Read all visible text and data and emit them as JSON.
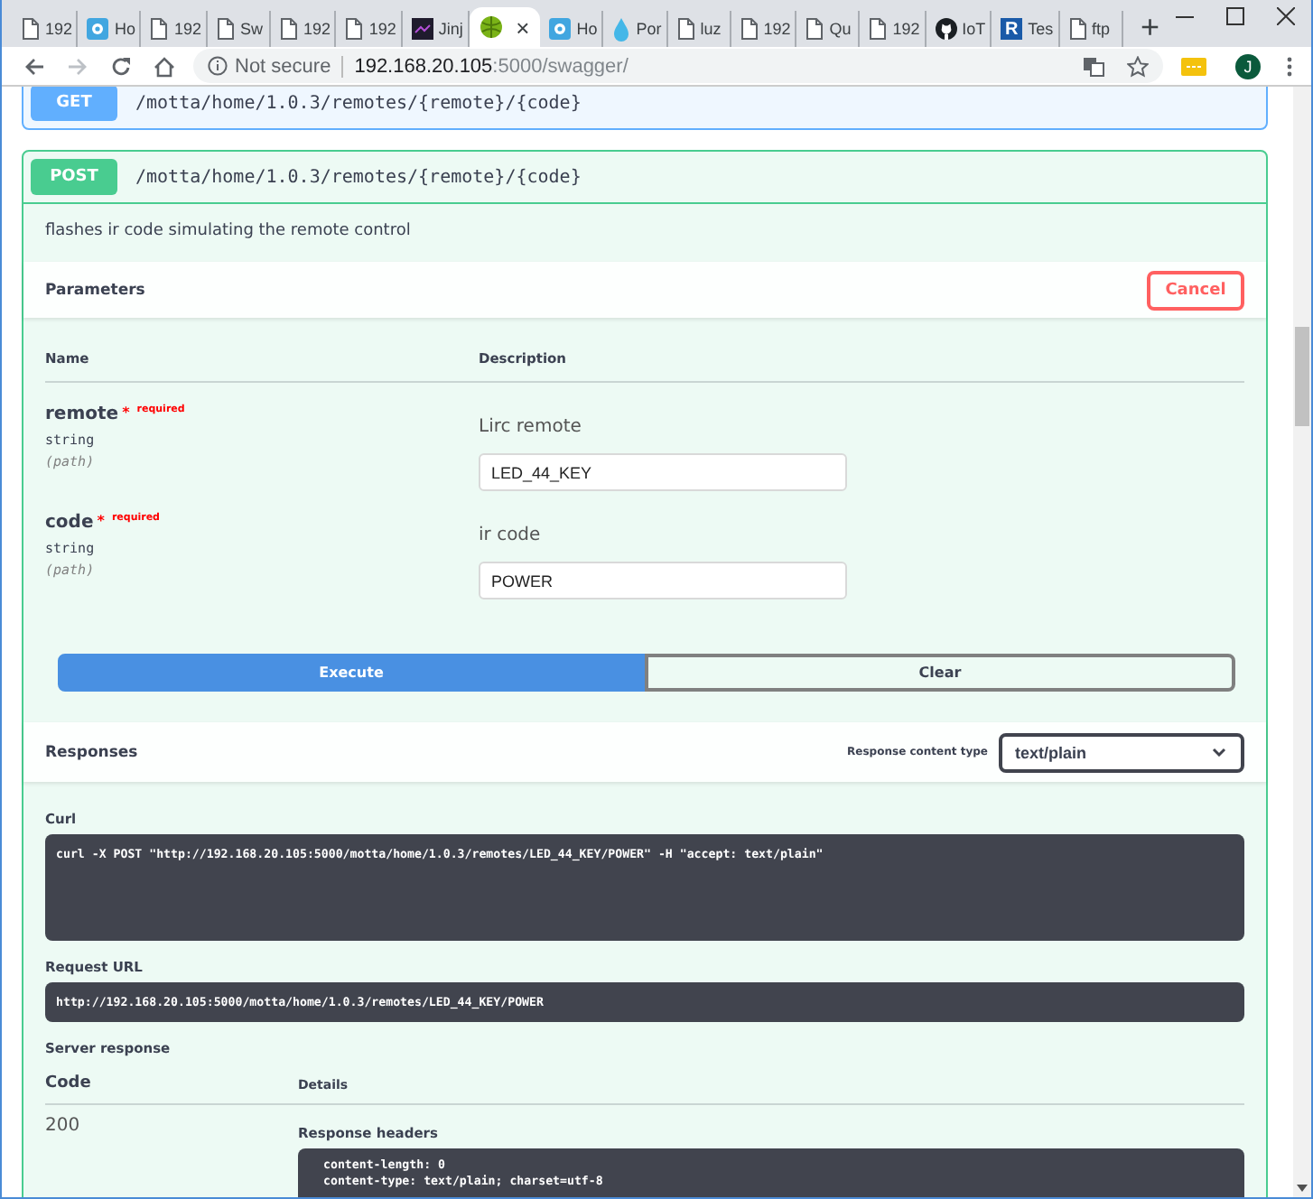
{
  "browser": {
    "tabs": [
      {
        "title": "192",
        "kind": "page",
        "selected": false
      },
      {
        "title": "Ho",
        "kind": "tile",
        "selected": false
      },
      {
        "title": "192",
        "kind": "page",
        "selected": false
      },
      {
        "title": "Sw",
        "kind": "page",
        "selected": false
      },
      {
        "title": "192",
        "kind": "page",
        "selected": false
      },
      {
        "title": "192",
        "kind": "page",
        "selected": false
      },
      {
        "title": "Jinj",
        "kind": "dark",
        "selected": false
      },
      {
        "kind": "ball",
        "selected": true,
        "close": "×"
      },
      {
        "title": "Ho",
        "kind": "tile",
        "selected": false
      },
      {
        "title": "Por",
        "kind": "drop",
        "selected": false
      },
      {
        "title": "luz",
        "kind": "page",
        "selected": false
      },
      {
        "title": "192",
        "kind": "page",
        "selected": false
      },
      {
        "title": "Qu",
        "kind": "page",
        "selected": false
      },
      {
        "title": "192",
        "kind": "page",
        "selected": false
      },
      {
        "title": "IoT",
        "kind": "cat",
        "selected": false
      },
      {
        "title": "Tes",
        "kind": "letter",
        "badge": "R",
        "selected": false
      },
      {
        "title": "ftp",
        "kind": "page",
        "selected": false
      }
    ],
    "new_tab": "+",
    "address": {
      "security": "Not secure",
      "host": "192.168.20.105",
      "rest": ":5000/swagger/"
    },
    "profile": "J"
  },
  "operations": [
    {
      "method": "GET",
      "path": "/motta/home/1.0.3/remotes/{remote}/{code}",
      "color": "#61affe",
      "expanded": false
    },
    {
      "method": "POST",
      "path": "/motta/home/1.0.3/remotes/{remote}/{code}",
      "color": "#49cc90",
      "expanded": true
    }
  ],
  "post_details": {
    "description": "flashes ir code simulating the remote control",
    "parameters_title": "Parameters",
    "cancel_button": "Cancel",
    "columns": [
      "Name",
      "Description"
    ],
    "parameters": [
      {
        "name": "remote",
        "required_mark": "*",
        "required_label": "required",
        "type": "string",
        "location": "(path)",
        "description": "Lirc remote",
        "value": "LED_44_KEY"
      },
      {
        "name": "code",
        "required_mark": "*",
        "required_label": "required",
        "type": "string",
        "location": "(path)",
        "description": "ir code",
        "value": "POWER"
      }
    ],
    "execute_button": "Execute",
    "clear_button": "Clear"
  },
  "responses": {
    "title": "Responses",
    "content_type_label": "Response content type",
    "content_type": "text/plain",
    "curl_label": "Curl",
    "curl": "curl -X POST \"http://192.168.20.105:5000/motta/home/1.0.3/remotes/LED_44_KEY/POWER\" -H \"accept: text/plain\"",
    "request_url_label": "Request URL",
    "request_url": "http://192.168.20.105:5000/motta/home/1.0.3/remotes/LED_44_KEY/POWER",
    "server_response_label": "Server response",
    "columns": [
      "Code",
      "Details"
    ],
    "code": "200",
    "headers_label": "Response headers",
    "headers": [
      "content-length: 0",
      "content-type: text/plain; charset=utf-8"
    ]
  }
}
